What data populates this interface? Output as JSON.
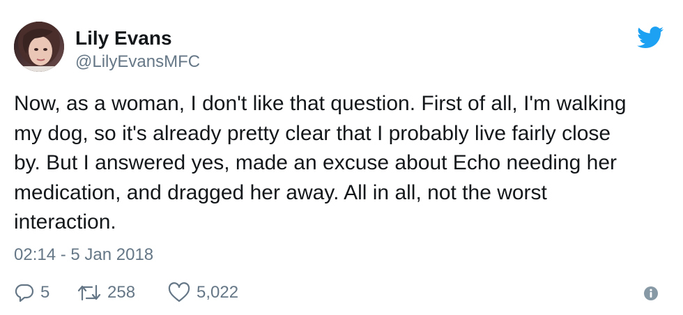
{
  "author": {
    "name": "Lily Evans",
    "handle": "@LilyEvansMFC",
    "avatar": "profile-photo"
  },
  "tweet": {
    "text_lines": [
      "Now, as a woman, I don't like that question. First of all, I'm walking",
      "my dog, so it's already pretty clear that I probably live fairly close",
      "by. But I answered yes, made an excuse about Echo needing her",
      "medication, and dragged her away. All in all, not the worst",
      "interaction."
    ],
    "timestamp": "02:14 - 5 Jan 2018"
  },
  "actions": {
    "replies": "5",
    "retweets": "258",
    "likes": "5,022"
  },
  "icons": {
    "brand": "twitter-bird-icon",
    "reply": "reply-icon",
    "retweet": "retweet-icon",
    "like": "heart-icon",
    "info": "info-icon"
  },
  "colors": {
    "brand": "#1da1f2",
    "text": "#14171a",
    "muted": "#657786",
    "background": "#ffffff"
  }
}
